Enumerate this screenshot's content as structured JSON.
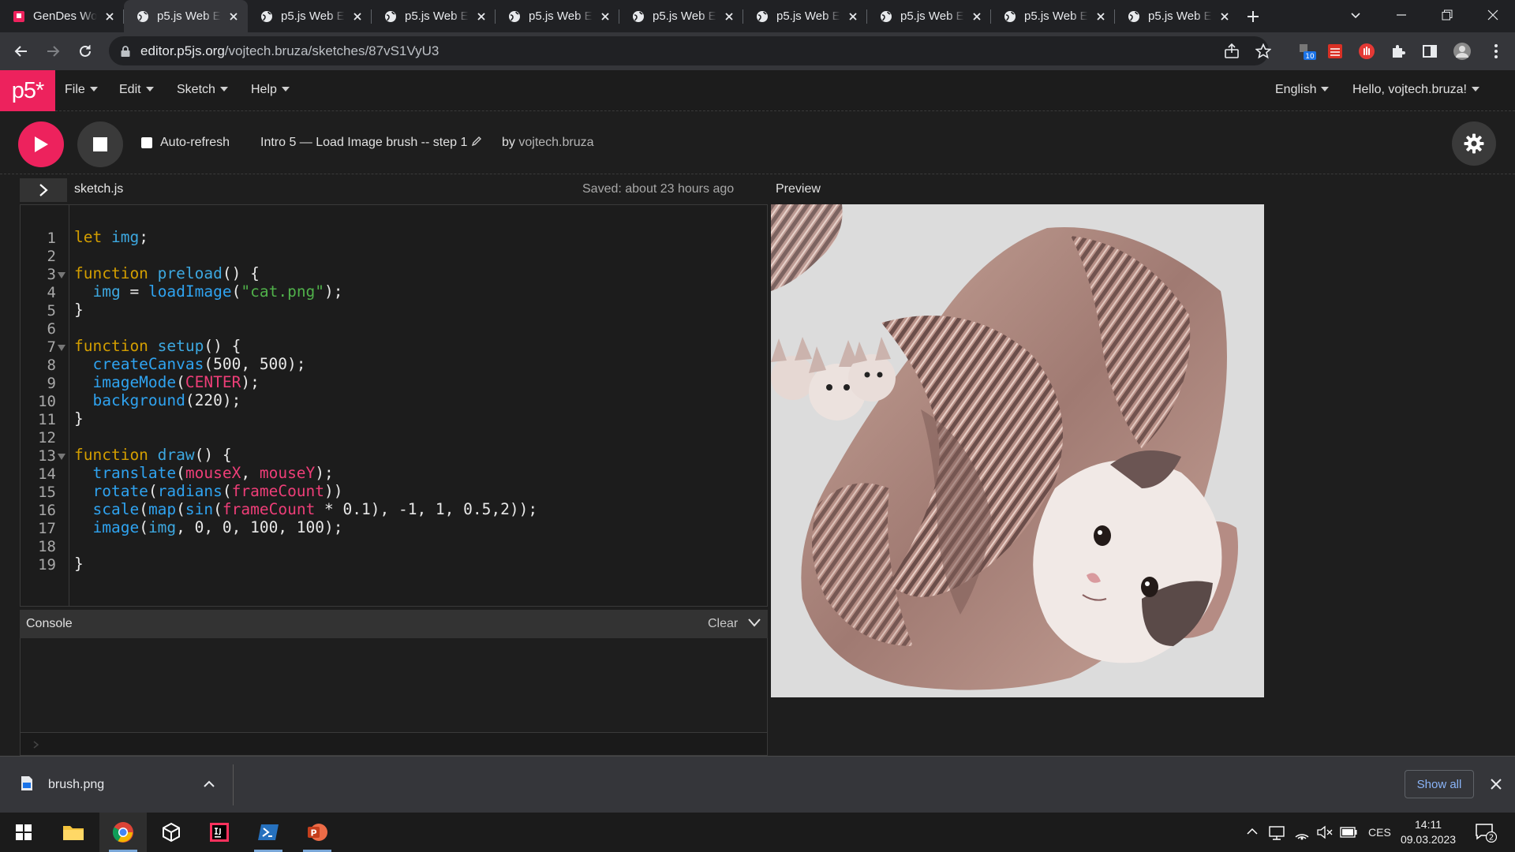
{
  "browser": {
    "tabs": [
      {
        "title": "GenDes Wo",
        "favicon": "p5-red-icon",
        "active": false
      },
      {
        "title": "p5.js Web E",
        "favicon": "globe-icon",
        "active": true
      },
      {
        "title": "p5.js Web E",
        "favicon": "globe-icon",
        "active": false
      },
      {
        "title": "p5.js Web E",
        "favicon": "globe-icon",
        "active": false
      },
      {
        "title": "p5.js Web E",
        "favicon": "globe-icon",
        "active": false
      },
      {
        "title": "p5.js Web E",
        "favicon": "globe-icon",
        "active": false
      },
      {
        "title": "p5.js Web E",
        "favicon": "globe-icon",
        "active": false
      },
      {
        "title": "p5.js Web E",
        "favicon": "globe-icon",
        "active": false
      },
      {
        "title": "p5.js Web E",
        "favicon": "globe-icon",
        "active": false
      },
      {
        "title": "p5.js Web E",
        "favicon": "globe-icon",
        "active": false
      }
    ],
    "url_host": "editor.p5js.org",
    "url_path": "/vojtech.bruza/sketches/87vS1VyU3",
    "extension_badge": "10"
  },
  "p5nav": {
    "logo": "p5*",
    "menus": [
      "File",
      "Edit",
      "Sketch",
      "Help"
    ],
    "language": "English",
    "greeting": "Hello, vojtech.bruza!"
  },
  "toolbar": {
    "auto_refresh_label": "Auto-refresh",
    "auto_refresh_checked": false,
    "sketch_name": "Intro 5 — Load Image brush -- step 1",
    "by_label": "by",
    "author": "vojtech.bruza"
  },
  "editor": {
    "filename": "sketch.js",
    "saved_status": "Saved: about 23 hours ago",
    "line_numbers": [
      "1",
      "2",
      "3",
      "4",
      "5",
      "6",
      "7",
      "8",
      "9",
      "10",
      "11",
      "12",
      "13",
      "14",
      "15",
      "16",
      "17",
      "18",
      "19"
    ],
    "code_lines": [
      "let img;",
      "",
      "function preload() {",
      "  img = loadImage(\"cat.png\");",
      "}",
      "",
      "function setup() {",
      "  createCanvas(500, 500);",
      "  imageMode(CENTER);",
      "  background(220);",
      "}",
      "",
      "function draw() {",
      "  translate(mouseX, mouseY);",
      "  rotate(radians(frameCount))",
      "  scale(map(sin(frameCount * 0.1), -1, 1, 0.5,2));",
      "  image(img, 0, 0, 100, 100);",
      "",
      "}"
    ]
  },
  "console": {
    "title": "Console",
    "clear_label": "Clear"
  },
  "preview": {
    "label": "Preview"
  },
  "downloads": {
    "filename": "brush.png",
    "show_all": "Show all"
  },
  "taskbar": {
    "language": "CES",
    "time": "14:11",
    "date": "09.03.2023",
    "notification_count": "2"
  }
}
